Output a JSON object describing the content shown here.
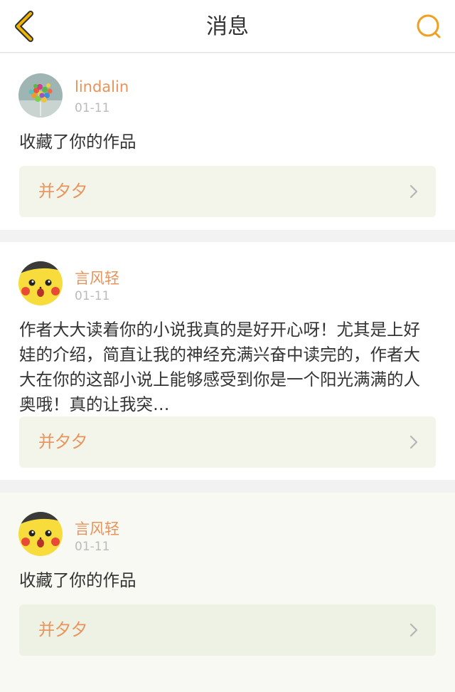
{
  "header": {
    "title": "消息",
    "back_icon": "chevron-left-icon",
    "search_icon": "search-icon",
    "accent": "#f0a020"
  },
  "messages": [
    {
      "username": "lindalin",
      "date": "01-11",
      "text": "收藏了你的作品",
      "work_title": "并夕夕",
      "avatar": "balloons-avatar"
    },
    {
      "username": "言风轻",
      "date": "01-11",
      "text": "作者大大读着你的小说我真的是好开心呀！尤其是上好娃的介绍，简直让我的神经充满兴奋中读完的，作者大大在你的这部小说上能够感受到你是一个阳光满满的人奥哦！真的让我突…",
      "work_title": "并夕夕",
      "avatar": "pikachu-avatar"
    },
    {
      "username": "言风轻",
      "date": "01-11",
      "text": "收藏了你的作品",
      "work_title": "并夕夕",
      "avatar": "pikachu-avatar"
    }
  ],
  "colors": {
    "username": "#e8935a",
    "date": "#bbbbbb",
    "text": "#333333",
    "link_bg": "#f3f5ea"
  }
}
